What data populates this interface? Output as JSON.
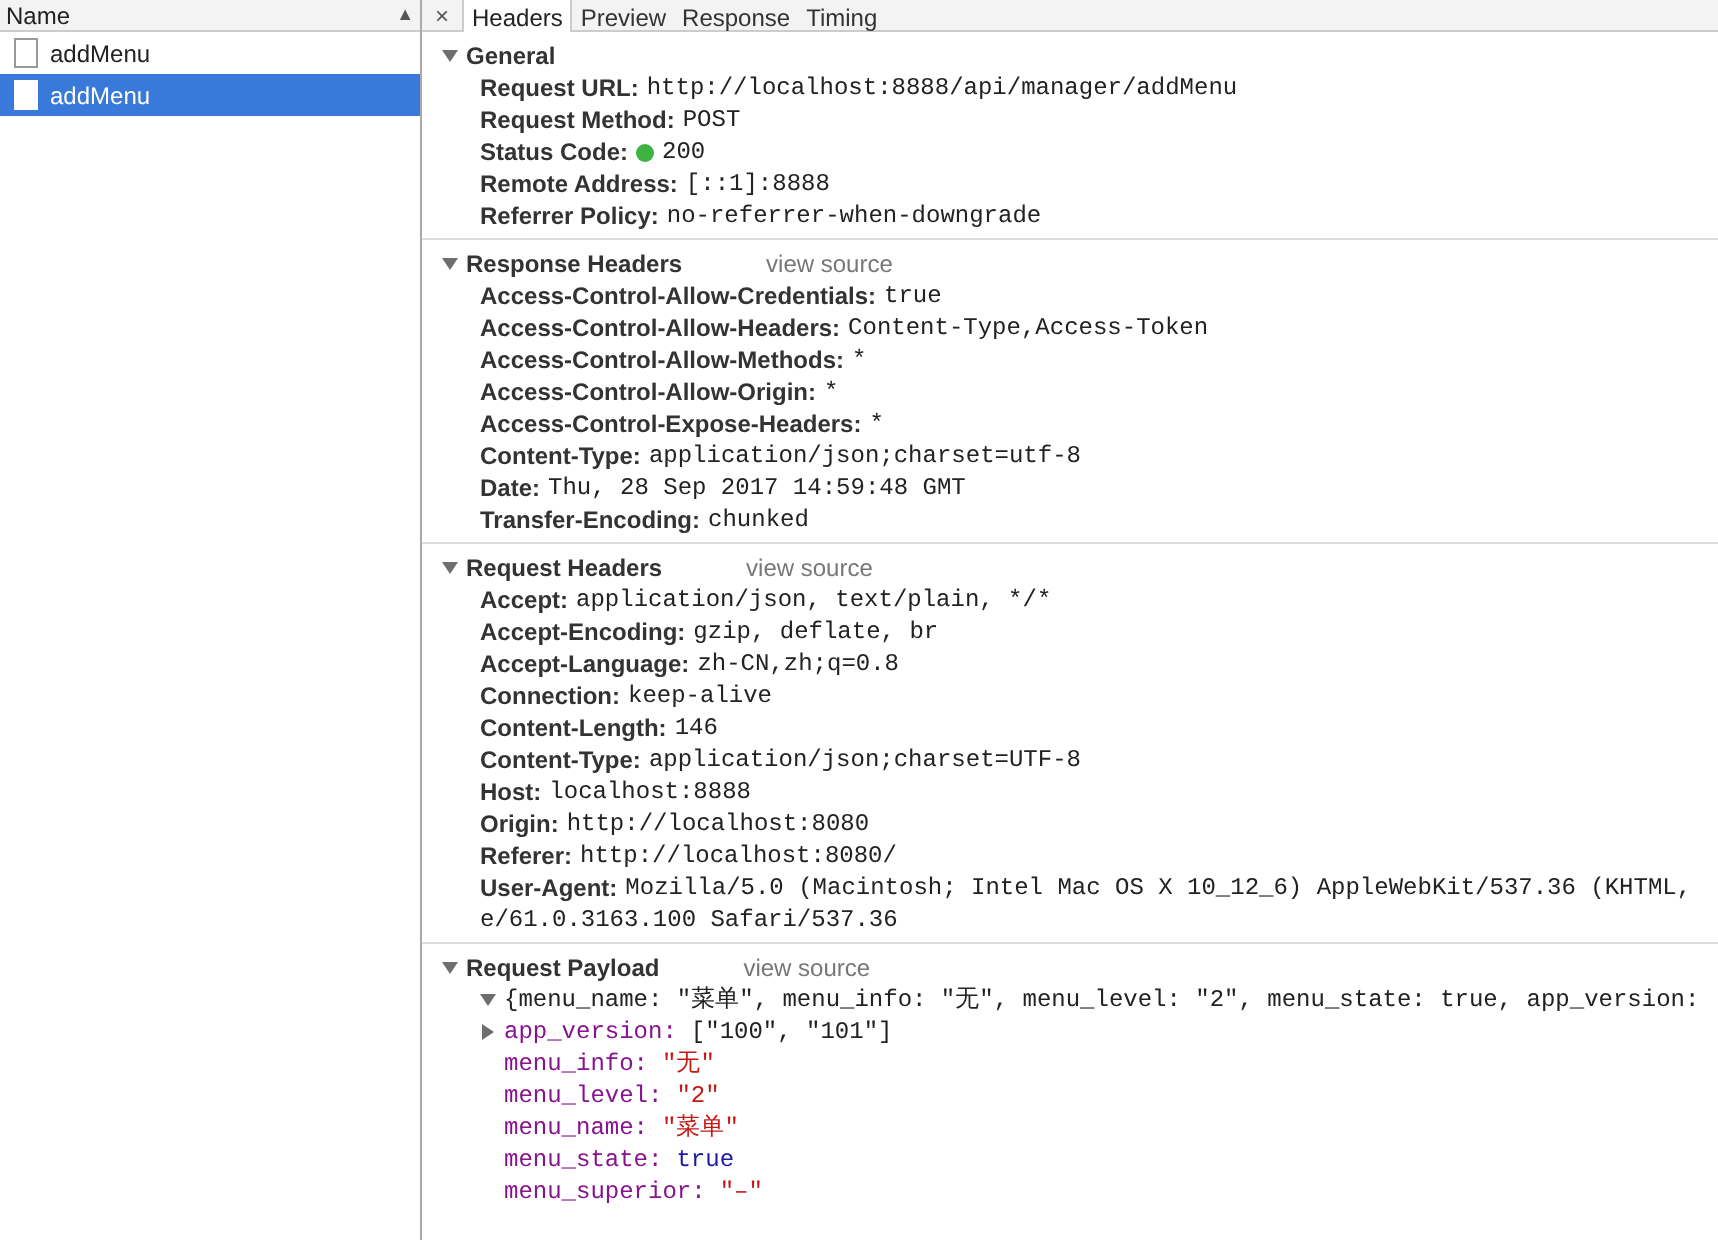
{
  "request_list": {
    "column_header": "Name",
    "sort_arrow": "▲",
    "items": [
      {
        "name": "addMenu",
        "selected": false
      },
      {
        "name": "addMenu",
        "selected": true
      }
    ]
  },
  "detail": {
    "close": "×",
    "tabs": [
      {
        "label": "Headers",
        "selected": true
      },
      {
        "label": "Preview",
        "selected": false
      },
      {
        "label": "Response",
        "selected": false
      },
      {
        "label": "Timing",
        "selected": false
      }
    ],
    "sections": [
      {
        "title": "General",
        "expanded": true,
        "rows": [
          {
            "name": "Request URL:",
            "value": "http://localhost:8888/api/manager/addMenu",
            "status_dot": false
          },
          {
            "name": "Request Method:",
            "value": "POST",
            "status_dot": false
          },
          {
            "name": "Status Code:",
            "value": "200",
            "status_dot": true
          },
          {
            "name": "Remote Address:",
            "value": "[::1]:8888",
            "status_dot": false
          },
          {
            "name": "Referrer Policy:",
            "value": "no-referrer-when-downgrade",
            "status_dot": false
          }
        ]
      },
      {
        "title": "Response Headers",
        "link": "view source",
        "expanded": true,
        "rows": [
          {
            "name": "Access-Control-Allow-Credentials:",
            "value": "true"
          },
          {
            "name": "Access-Control-Allow-Headers:",
            "value": "Content-Type,Access-Token"
          },
          {
            "name": "Access-Control-Allow-Methods:",
            "value": "*"
          },
          {
            "name": "Access-Control-Allow-Origin:",
            "value": "*"
          },
          {
            "name": "Access-Control-Expose-Headers:",
            "value": "*"
          },
          {
            "name": "Content-Type:",
            "value": "application/json;charset=utf-8"
          },
          {
            "name": "Date:",
            "value": "Thu, 28 Sep 2017 14:59:48 GMT"
          },
          {
            "name": "Transfer-Encoding:",
            "value": "chunked"
          }
        ]
      },
      {
        "title": "Request Headers",
        "link": "view source",
        "expanded": true,
        "rows": [
          {
            "name": "Accept:",
            "value": "application/json, text/plain, */*"
          },
          {
            "name": "Accept-Encoding:",
            "value": "gzip, deflate, br"
          },
          {
            "name": "Accept-Language:",
            "value": "zh-CN,zh;q=0.8"
          },
          {
            "name": "Connection:",
            "value": "keep-alive"
          },
          {
            "name": "Content-Length:",
            "value": "146"
          },
          {
            "name": "Content-Type:",
            "value": "application/json;charset=UTF-8"
          },
          {
            "name": "Host:",
            "value": "localhost:8888"
          },
          {
            "name": "Origin:",
            "value": "http://localhost:8080"
          },
          {
            "name": "Referer:",
            "value": "http://localhost:8080/"
          },
          {
            "name": "User-Agent:",
            "value": "Mozilla/5.0 (Macintosh; Intel Mac OS X 10_12_6) AppleWebKit/537.36 (KHTML,",
            "continuation": "e/61.0.3163.100 Safari/537.36"
          }
        ]
      }
    ],
    "payload": {
      "title": "Request Payload",
      "link": "view source",
      "expanded": true,
      "summary": "{menu_name: \"菜单\", menu_info: \"无\", menu_level: \"2\", menu_state: true, app_version:",
      "summary_expanded": true,
      "properties": [
        {
          "key": "app_version:",
          "value": "[\"100\", \"101\"]",
          "kind": "array",
          "expanded": false
        },
        {
          "key": "menu_info:",
          "value": "\"无\"",
          "kind": "string"
        },
        {
          "key": "menu_level:",
          "value": "\"2\"",
          "kind": "string"
        },
        {
          "key": "menu_name:",
          "value": "\"菜单\"",
          "kind": "string"
        },
        {
          "key": "menu_state:",
          "value": "true",
          "kind": "boolean"
        },
        {
          "key": "menu_superior:",
          "value": "\"–\"",
          "kind": "string"
        }
      ]
    }
  }
}
